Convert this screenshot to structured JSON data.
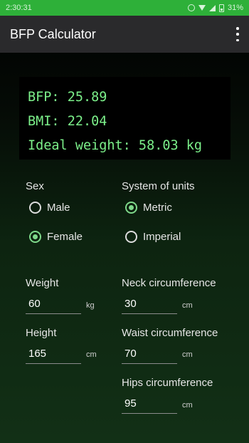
{
  "status_bar": {
    "time": "2:30:31",
    "battery": "31%",
    "icons": [
      "alarm-icon",
      "wifi-icon",
      "signal-icon",
      "battery-icon"
    ]
  },
  "app_bar": {
    "title": "BFP Calculator",
    "menu_icon": "overflow-menu-icon"
  },
  "results": {
    "bfp": "BFP: 25.89",
    "bmi": "BMI: 22.04",
    "ideal_weight": "Ideal weight: 58.03 kg",
    "text_color": "#7cf08a"
  },
  "sex": {
    "label": "Sex",
    "options": [
      {
        "label": "Male",
        "checked": false
      },
      {
        "label": "Female",
        "checked": true
      }
    ]
  },
  "units_system": {
    "label": "System of units",
    "options": [
      {
        "label": "Metric",
        "checked": true
      },
      {
        "label": "Imperial",
        "checked": false
      }
    ]
  },
  "fields": {
    "weight": {
      "label": "Weight",
      "value": "60",
      "unit": "kg"
    },
    "height": {
      "label": "Height",
      "value": "165",
      "unit": "cm"
    },
    "neck": {
      "label": "Neck circumference",
      "value": "30",
      "unit": "cm"
    },
    "waist": {
      "label": "Waist circumference",
      "value": "70",
      "unit": "cm"
    },
    "hips": {
      "label": "Hips circumference",
      "value": "95",
      "unit": "cm"
    }
  },
  "colors": {
    "status_bar": "#2eb039",
    "app_bar": "#2a2a2c",
    "accent": "#7ed88a"
  }
}
